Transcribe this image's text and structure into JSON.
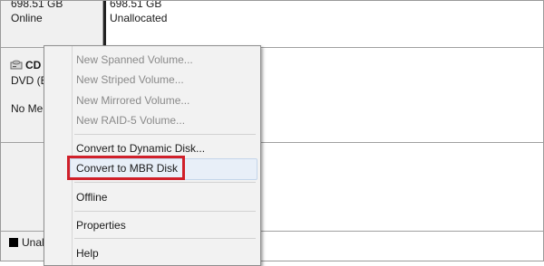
{
  "disk_top": {
    "size": "698.51 GB",
    "status": "Online"
  },
  "partition_top": {
    "size": "698.51 GB",
    "status": "Unallocated"
  },
  "cd_disk": {
    "label": "CD",
    "type": "DVD (E",
    "media": "No Me"
  },
  "legend": {
    "label": "Unal"
  },
  "context_menu": {
    "items": [
      {
        "label": "New Spanned Volume..."
      },
      {
        "label": "New Striped Volume..."
      },
      {
        "label": "New Mirrored Volume..."
      },
      {
        "label": "New RAID-5 Volume..."
      },
      {
        "label": "Convert to Dynamic Disk..."
      },
      {
        "label": "Convert to MBR Disk"
      },
      {
        "label": "Offline"
      },
      {
        "label": "Properties"
      },
      {
        "label": "Help"
      }
    ]
  },
  "colors": {
    "highlight_box": "#d0202a",
    "hover_background": "#e8eff8"
  }
}
